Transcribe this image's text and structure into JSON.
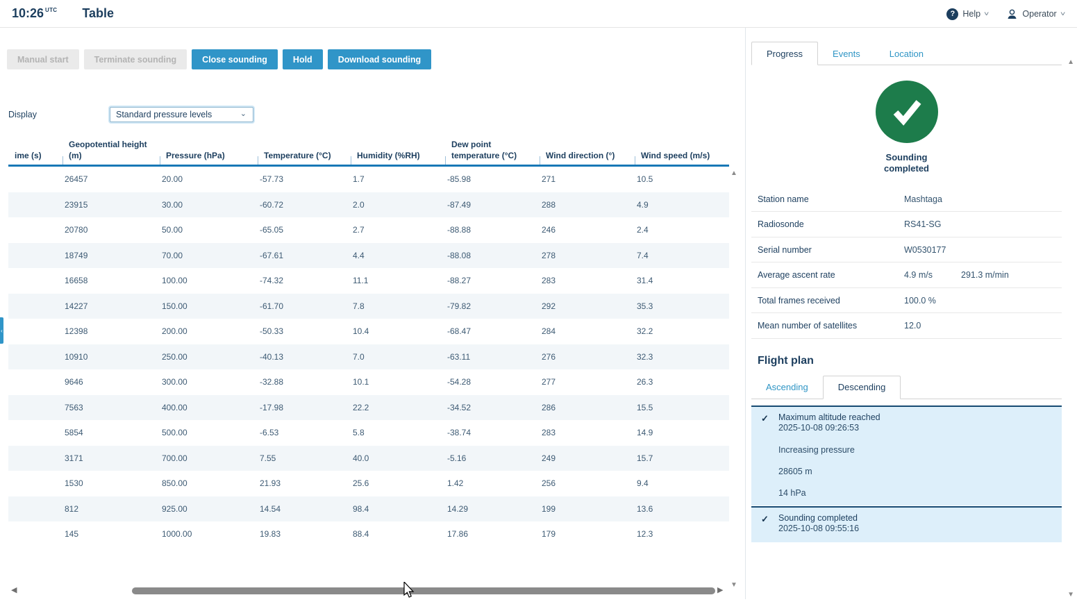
{
  "colors": {
    "accent_blue": "#3095c8",
    "link_blue": "#2f95c5",
    "navy_text": "#1c3e5e",
    "success_green": "#1d7c4b",
    "header_rule_blue": "#1878b6",
    "event_box_bg": "#ddeffa",
    "disabled_bg": "#eaeaea",
    "row_stripe": "#f2f6f9"
  },
  "icons": {
    "help": "?",
    "chevron_down": "˅",
    "select_chevron": "⌄",
    "scroll_up": "▲",
    "scroll_down": "▼",
    "scroll_left": "◀",
    "scroll_right": "▶",
    "check": "✓",
    "collapse_handle": "‹"
  },
  "header": {
    "time": "10:26",
    "time_suffix": "UTC",
    "title": "Table",
    "help_label": "Help",
    "user_label": "Operator"
  },
  "toolbar": {
    "buttons": [
      {
        "label": "Manual start",
        "enabled": false
      },
      {
        "label": "Terminate sounding",
        "enabled": false
      },
      {
        "label": "Close sounding",
        "enabled": true
      },
      {
        "label": "Hold",
        "enabled": true
      },
      {
        "label": "Download sounding",
        "enabled": true
      }
    ]
  },
  "display": {
    "label": "Display",
    "selected": "Standard pressure levels"
  },
  "table": {
    "columns": [
      "ime (s)",
      "Geopotential height (m)",
      "Pressure (hPa)",
      "Temperature (°C)",
      "Humidity (%RH)",
      "Dew point temperature (°C)",
      "Wind direction (°)",
      "Wind speed (m/s)"
    ],
    "rows": [
      [
        "",
        "26457",
        "20.00",
        "-57.73",
        "1.7",
        "-85.98",
        "271",
        "10.5"
      ],
      [
        "",
        "23915",
        "30.00",
        "-60.72",
        "2.0",
        "-87.49",
        "288",
        "4.9"
      ],
      [
        "",
        "20780",
        "50.00",
        "-65.05",
        "2.7",
        "-88.88",
        "246",
        "2.4"
      ],
      [
        "",
        "18749",
        "70.00",
        "-67.61",
        "4.4",
        "-88.08",
        "278",
        "7.4"
      ],
      [
        "",
        "16658",
        "100.00",
        "-74.32",
        "11.1",
        "-88.27",
        "283",
        "31.4"
      ],
      [
        "",
        "14227",
        "150.00",
        "-61.70",
        "7.8",
        "-79.82",
        "292",
        "35.3"
      ],
      [
        "",
        "12398",
        "200.00",
        "-50.33",
        "10.4",
        "-68.47",
        "284",
        "32.2"
      ],
      [
        "",
        "10910",
        "250.00",
        "-40.13",
        "7.0",
        "-63.11",
        "276",
        "32.3"
      ],
      [
        "",
        "9646",
        "300.00",
        "-32.88",
        "10.1",
        "-54.28",
        "277",
        "26.3"
      ],
      [
        "",
        "7563",
        "400.00",
        "-17.98",
        "22.2",
        "-34.52",
        "286",
        "15.5"
      ],
      [
        "",
        "5854",
        "500.00",
        "-6.53",
        "5.8",
        "-38.74",
        "283",
        "14.9"
      ],
      [
        "",
        "3171",
        "700.00",
        "7.55",
        "40.0",
        "-5.16",
        "249",
        "15.7"
      ],
      [
        "",
        "1530",
        "850.00",
        "21.93",
        "25.6",
        "1.42",
        "256",
        "9.4"
      ],
      [
        "",
        "812",
        "925.00",
        "14.54",
        "98.4",
        "14.29",
        "199",
        "13.6"
      ],
      [
        "",
        "145",
        "1000.00",
        "19.83",
        "88.4",
        "17.86",
        "179",
        "12.3"
      ]
    ]
  },
  "panel": {
    "tabs": [
      {
        "label": "Progress",
        "active": true
      },
      {
        "label": "Events",
        "active": false
      },
      {
        "label": "Location",
        "active": false
      }
    ],
    "status_label": "Sounding completed",
    "info": [
      {
        "label": "Station name",
        "value": "Mashtaga",
        "value2": ""
      },
      {
        "label": "Radiosonde",
        "value": "RS41-SG",
        "value2": ""
      },
      {
        "label": "Serial number",
        "value": "W0530177",
        "value2": ""
      },
      {
        "label": "Average ascent rate",
        "value": "4.9 m/s",
        "value2": "291.3 m/min"
      },
      {
        "label": "Total frames received",
        "value": "100.0 %",
        "value2": ""
      },
      {
        "label": "Mean number of satellites",
        "value": "12.0",
        "value2": ""
      }
    ],
    "flight_plan": {
      "title": "Flight plan",
      "tabs": [
        {
          "label": "Ascending",
          "active": false
        },
        {
          "label": "Descending",
          "active": true
        }
      ],
      "events": [
        {
          "checked": true,
          "title": "Maximum altitude reached",
          "timestamp": "2025-10-08 09:26:53",
          "details": [
            "Increasing pressure",
            "28605 m",
            "14 hPa"
          ]
        },
        {
          "checked": true,
          "title": "Sounding completed",
          "timestamp": "2025-10-08 09:55:16",
          "details": []
        }
      ]
    }
  }
}
